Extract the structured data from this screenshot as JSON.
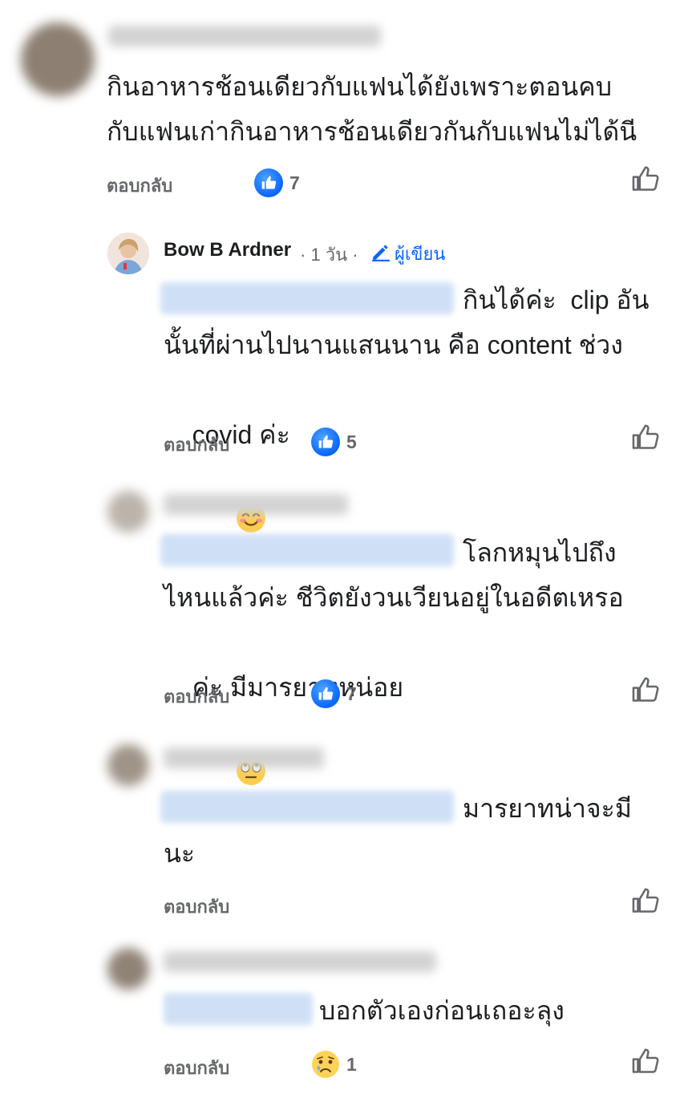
{
  "reply_label": "ตอบกลับ",
  "comments": [
    {
      "text_lines": [
        "กินอาหารช้อนเดียวกับแฟนได้ยังเพราะตอนคบ",
        "กับแฟนเก่ากินอาหารช้อนเดียวกันกับแฟนไม่ได้นี"
      ],
      "reaction": "like",
      "reaction_count": "7"
    },
    {
      "name": "Bow B Ardner",
      "time": "· 1 วัน ·",
      "author_label": "ผู้เขียน",
      "text_lines": [
        "กินได้ค่ะ  clip อัน",
        "นั้นที่ผ่านไปนานแสนนาน คือ content ช่วง",
        "covid ค่ะ"
      ],
      "reaction": "like",
      "reaction_count": "5"
    },
    {
      "text_lines": [
        "โลกหมุนไปถึง",
        "ไหนแล้วค่ะ ชีวิตยังวนเวียนอยู่ในอดีตเหรอ",
        "ค่ะ มีมารยาทหน่อย"
      ],
      "reaction": "like",
      "reaction_count": "7"
    },
    {
      "text_lines": [
        "มารยาทน่าจะมี",
        "นะ"
      ],
      "reaction": "none",
      "reaction_count": ""
    },
    {
      "text_lines": [
        "บอกตัวเองก่อนเถอะลุง"
      ],
      "reaction": "sad",
      "reaction_count": "1"
    }
  ],
  "colors": {
    "like_blue": "#0866ff",
    "author_blue": "#0866ff",
    "mention_bg": "#cfe0f6",
    "secondary_text": "#65676b"
  },
  "icons": {
    "like": "thumbs-up-icon",
    "sad": "sad-face-icon",
    "author": "pencil-icon",
    "smile": "smiling-face-emoji",
    "eyeroll": "eye-roll-emoji"
  }
}
